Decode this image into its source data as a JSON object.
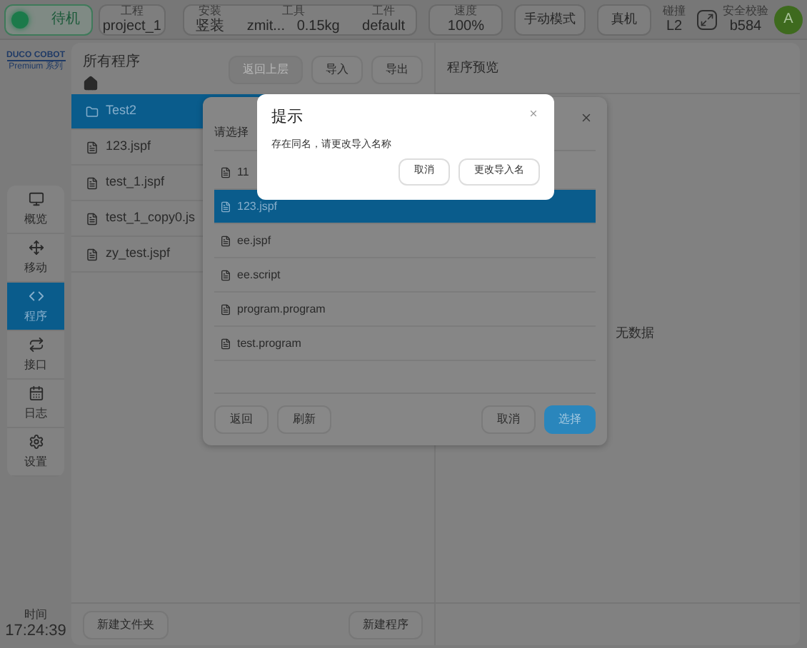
{
  "top_bar": {
    "status": {
      "label": "待机"
    },
    "project": {
      "caption": "工程",
      "value": "project_1"
    },
    "setup": [
      {
        "caption": "安装",
        "value": "竖装"
      },
      {
        "caption": "工具",
        "value": "zmit...   0.15kg"
      },
      {
        "caption": "工件",
        "value": "default"
      }
    ],
    "speed": {
      "caption": "速度",
      "value": "100%"
    },
    "buttons": [
      "手动模式",
      "真机"
    ],
    "collision": {
      "caption": "碰撞",
      "value": "L2"
    },
    "safety": {
      "caption": "安全校验",
      "value": "b584"
    },
    "avatar": "A"
  },
  "sidebar": {
    "logo": {
      "name": "DUCO COBOT",
      "series": "Premium 系列"
    },
    "items": [
      {
        "label": "概览",
        "selected": false
      },
      {
        "label": "移动",
        "selected": false
      },
      {
        "label": "程序",
        "selected": true
      },
      {
        "label": "接口",
        "selected": false
      },
      {
        "label": "日志",
        "selected": false
      },
      {
        "label": "设置",
        "selected": false
      }
    ],
    "time": {
      "caption": "时间",
      "value": "17:24:39"
    }
  },
  "program_panel": {
    "title": "所有程序",
    "buttons": [
      {
        "label": "返回上层",
        "disabled": true
      },
      {
        "label": "导入",
        "disabled": false
      },
      {
        "label": "导出",
        "disabled": false
      }
    ],
    "items": [
      {
        "name": "Test2",
        "kind": "folder",
        "selected": true
      },
      {
        "name": "123.jspf",
        "kind": "file",
        "selected": false
      },
      {
        "name": "test_1.jspf",
        "kind": "file",
        "selected": false
      },
      {
        "name": "test_1_copy0.js",
        "kind": "file",
        "selected": false
      },
      {
        "name": "zy_test.jspf",
        "kind": "file",
        "selected": false
      }
    ],
    "footer_buttons": [
      "新建文件夹",
      "新建程序"
    ]
  },
  "preview": {
    "title": "程序预览",
    "empty": "无数据"
  },
  "file_dialog": {
    "title": "请选择",
    "items": [
      {
        "name": "11",
        "selected": false
      },
      {
        "name": "123.jspf",
        "selected": true
      },
      {
        "name": "ee.jspf",
        "selected": false
      },
      {
        "name": "ee.script",
        "selected": false
      },
      {
        "name": "program.program",
        "selected": false
      },
      {
        "name": "test.program",
        "selected": false
      }
    ],
    "left_buttons": [
      "返回",
      "刷新"
    ],
    "right_buttons": [
      {
        "label": "取消",
        "primary": false
      },
      {
        "label": "选择",
        "primary": true
      }
    ]
  },
  "prompt": {
    "title": "提示",
    "message": "存在同名，请更改导入名称",
    "buttons": [
      "取消",
      "更改导入名"
    ]
  }
}
